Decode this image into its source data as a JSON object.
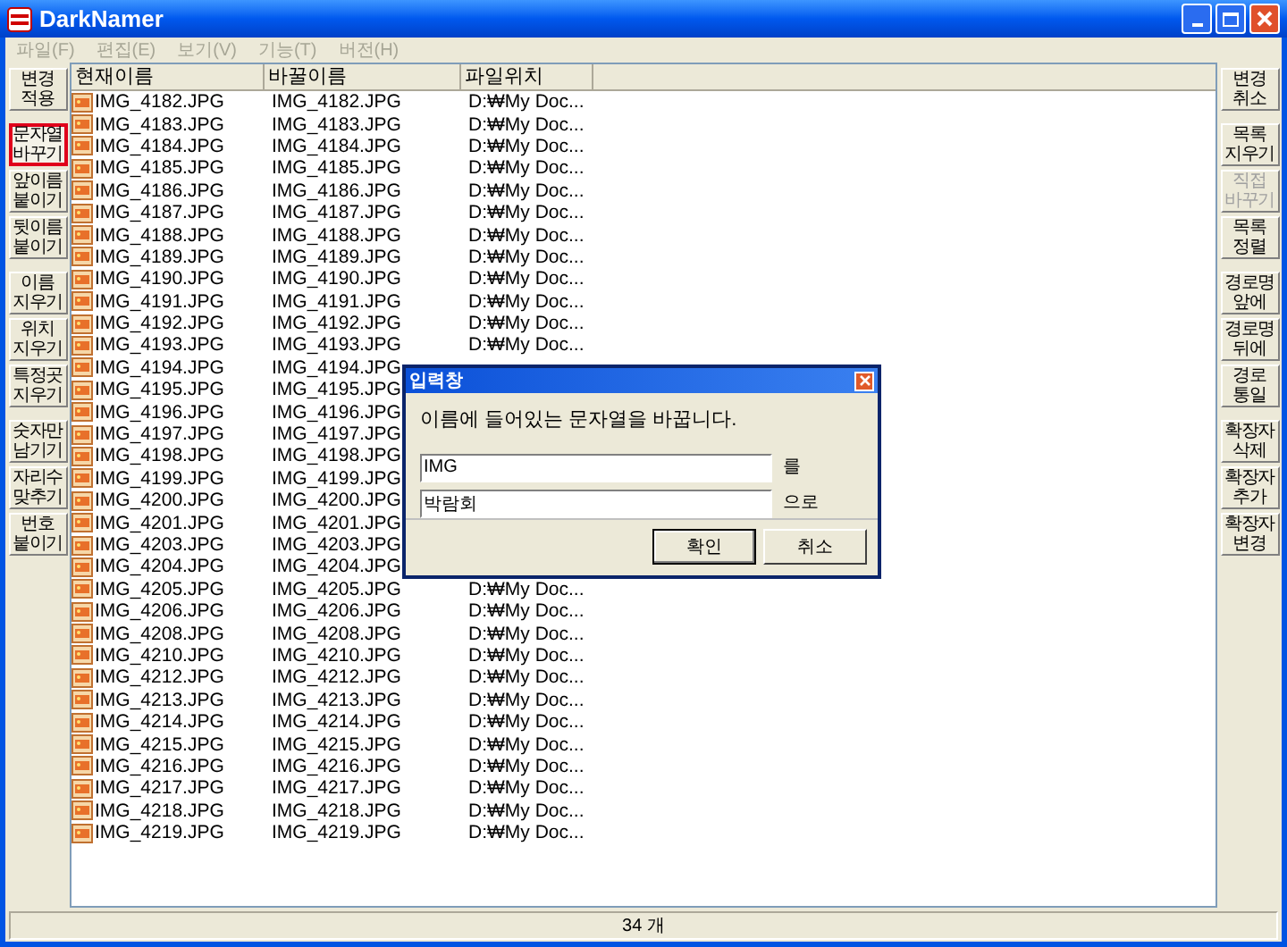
{
  "window": {
    "title": "DarkNamer"
  },
  "menu": [
    {
      "label": "파일(F)",
      "disabled": true
    },
    {
      "label": "편집(E)",
      "disabled": true
    },
    {
      "label": "보기(V)",
      "disabled": true
    },
    {
      "label": "기능(T)",
      "disabled": true
    },
    {
      "label": "버전(H)",
      "disabled": true
    }
  ],
  "left_toolbar": [
    {
      "buttons": [
        {
          "label": "변경\n적용",
          "selected": false,
          "disabled": false
        }
      ]
    },
    {
      "buttons": [
        {
          "label": "문자열\n바꾸기",
          "selected": true,
          "disabled": false
        },
        {
          "label": "앞이름\n붙이기",
          "selected": false,
          "disabled": false
        },
        {
          "label": "뒷이름\n붙이기",
          "selected": false,
          "disabled": false
        }
      ]
    },
    {
      "buttons": [
        {
          "label": "이름\n지우기",
          "selected": false,
          "disabled": false
        },
        {
          "label": "위치\n지우기",
          "selected": false,
          "disabled": false
        },
        {
          "label": "특정곳\n지우기",
          "selected": false,
          "disabled": false
        }
      ]
    },
    {
      "buttons": [
        {
          "label": "숫자만\n남기기",
          "selected": false,
          "disabled": false
        },
        {
          "label": "자리수\n맞추기",
          "selected": false,
          "disabled": false
        },
        {
          "label": "번호\n붙이기",
          "selected": false,
          "disabled": false
        }
      ]
    }
  ],
  "right_toolbar": [
    {
      "buttons": [
        {
          "label": "변경\n취소",
          "selected": false,
          "disabled": false
        }
      ]
    },
    {
      "buttons": [
        {
          "label": "목록\n지우기",
          "selected": false,
          "disabled": false
        },
        {
          "label": "직접\n바꾸기",
          "selected": false,
          "disabled": true
        },
        {
          "label": "목록\n정렬",
          "selected": false,
          "disabled": false
        }
      ]
    },
    {
      "buttons": [
        {
          "label": "경로명\n앞에",
          "selected": false,
          "disabled": false
        },
        {
          "label": "경로명\n뒤에",
          "selected": false,
          "disabled": false
        },
        {
          "label": "경로\n통일",
          "selected": false,
          "disabled": false
        }
      ]
    },
    {
      "buttons": [
        {
          "label": "확장자\n삭제",
          "selected": false,
          "disabled": false
        },
        {
          "label": "확장자\n추가",
          "selected": false,
          "disabled": false
        },
        {
          "label": "확장자\n변경",
          "selected": false,
          "disabled": false
        }
      ]
    }
  ],
  "table": {
    "columns": [
      "현재이름",
      "바꿀이름",
      "파일위치"
    ],
    "rows": [
      {
        "name": "IMG_4182.JPG",
        "new_name": "IMG_4182.JPG",
        "location": "D:₩My Doc..."
      },
      {
        "name": "IMG_4183.JPG",
        "new_name": "IMG_4183.JPG",
        "location": "D:₩My Doc..."
      },
      {
        "name": "IMG_4184.JPG",
        "new_name": "IMG_4184.JPG",
        "location": "D:₩My Doc..."
      },
      {
        "name": "IMG_4185.JPG",
        "new_name": "IMG_4185.JPG",
        "location": "D:₩My Doc..."
      },
      {
        "name": "IMG_4186.JPG",
        "new_name": "IMG_4186.JPG",
        "location": "D:₩My Doc..."
      },
      {
        "name": "IMG_4187.JPG",
        "new_name": "IMG_4187.JPG",
        "location": "D:₩My Doc..."
      },
      {
        "name": "IMG_4188.JPG",
        "new_name": "IMG_4188.JPG",
        "location": "D:₩My Doc..."
      },
      {
        "name": "IMG_4189.JPG",
        "new_name": "IMG_4189.JPG",
        "location": "D:₩My Doc..."
      },
      {
        "name": "IMG_4190.JPG",
        "new_name": "IMG_4190.JPG",
        "location": "D:₩My Doc..."
      },
      {
        "name": "IMG_4191.JPG",
        "new_name": "IMG_4191.JPG",
        "location": "D:₩My Doc..."
      },
      {
        "name": "IMG_4192.JPG",
        "new_name": "IMG_4192.JPG",
        "location": "D:₩My Doc..."
      },
      {
        "name": "IMG_4193.JPG",
        "new_name": "IMG_4193.JPG",
        "location": "D:₩My Doc..."
      },
      {
        "name": "IMG_4194.JPG",
        "new_name": "IMG_4194.JPG"
      },
      {
        "name": "IMG_4195.JPG",
        "new_name": "IMG_4195.JPG"
      },
      {
        "name": "IMG_4196.JPG",
        "new_name": "IMG_4196.JPG"
      },
      {
        "name": "IMG_4197.JPG",
        "new_name": "IMG_4197.JPG"
      },
      {
        "name": "IMG_4198.JPG",
        "new_name": "IMG_4198.JPG"
      },
      {
        "name": "IMG_4199.JPG",
        "new_name": "IMG_4199.JPG"
      },
      {
        "name": "IMG_4200.JPG",
        "new_name": "IMG_4200.JPG"
      },
      {
        "name": "IMG_4201.JPG",
        "new_name": "IMG_4201.JPG"
      },
      {
        "name": "IMG_4203.JPG",
        "new_name": "IMG_4203.JPG"
      },
      {
        "name": "IMG_4204.JPG",
        "new_name": "IMG_4204.JPG"
      },
      {
        "name": "IMG_4205.JPG",
        "new_name": "IMG_4205.JPG",
        "location": "D:₩My Doc..."
      },
      {
        "name": "IMG_4206.JPG",
        "new_name": "IMG_4206.JPG",
        "location": "D:₩My Doc..."
      },
      {
        "name": "IMG_4208.JPG",
        "new_name": "IMG_4208.JPG",
        "location": "D:₩My Doc..."
      },
      {
        "name": "IMG_4210.JPG",
        "new_name": "IMG_4210.JPG",
        "location": "D:₩My Doc..."
      },
      {
        "name": "IMG_4212.JPG",
        "new_name": "IMG_4212.JPG",
        "location": "D:₩My Doc..."
      },
      {
        "name": "IMG_4213.JPG",
        "new_name": "IMG_4213.JPG",
        "location": "D:₩My Doc..."
      },
      {
        "name": "IMG_4214.JPG",
        "new_name": "IMG_4214.JPG",
        "location": "D:₩My Doc..."
      },
      {
        "name": "IMG_4215.JPG",
        "new_name": "IMG_4215.JPG",
        "location": "D:₩My Doc..."
      },
      {
        "name": "IMG_4216.JPG",
        "new_name": "IMG_4216.JPG",
        "location": "D:₩My Doc..."
      },
      {
        "name": "IMG_4217.JPG",
        "new_name": "IMG_4217.JPG",
        "location": "D:₩My Doc..."
      },
      {
        "name": "IMG_4218.JPG",
        "new_name": "IMG_4218.JPG",
        "location": "D:₩My Doc..."
      },
      {
        "name": "IMG_4219.JPG",
        "new_name": "IMG_4219.JPG",
        "location": "D:₩My Doc..."
      }
    ]
  },
  "dialog": {
    "title": "입력창",
    "message": "이름에 들어있는 문자열을 바꿉니다.",
    "fields": [
      {
        "value": "IMG",
        "suffix": "를"
      },
      {
        "value": "박람회",
        "suffix": "으로"
      }
    ],
    "buttons": [
      {
        "label": "확인",
        "default": true
      },
      {
        "label": "취소",
        "default": false
      }
    ]
  },
  "status_bar": "34 개"
}
